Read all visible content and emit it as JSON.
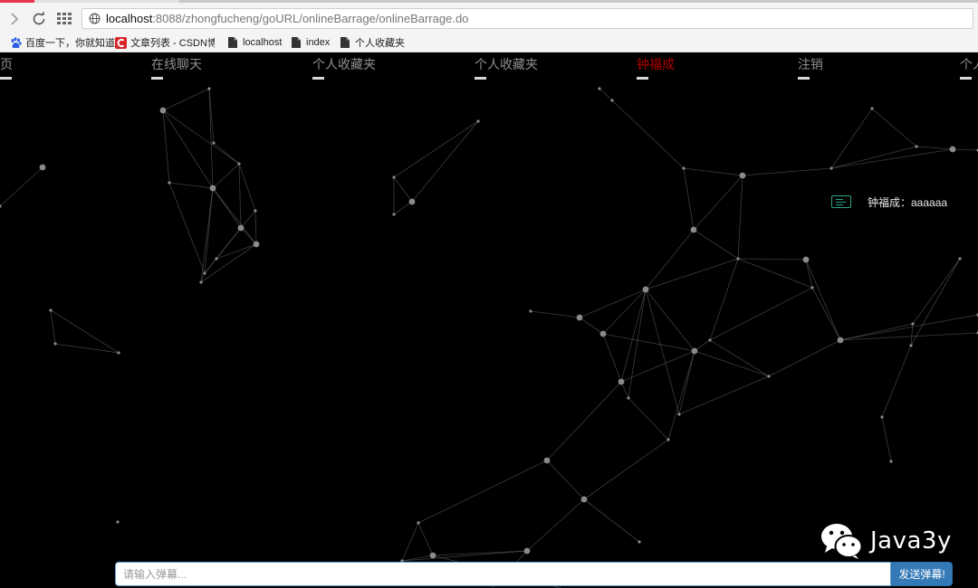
{
  "browser": {
    "url_host": "localhost",
    "url_rest": ":8088/zhongfucheng/goURL/onlineBarrage/onlineBarrage.do"
  },
  "bookmarks": [
    {
      "label": "百度一下，你就知道",
      "icon": "baidu-paw-icon"
    },
    {
      "label": "文章列表 - CSDN博客",
      "icon": "csdn-logo-icon"
    },
    {
      "label": "localhost",
      "icon": "page-icon"
    },
    {
      "label": "index",
      "icon": "page-icon"
    },
    {
      "label": "个人收藏夹",
      "icon": "page-icon"
    }
  ],
  "nav": {
    "items": [
      {
        "label": "页",
        "active": false
      },
      {
        "label": "在线聊天",
        "active": false
      },
      {
        "label": "个人收藏夹",
        "active": false
      },
      {
        "label": "个人收藏夹",
        "active": false
      },
      {
        "label": "钟福成",
        "active": true
      },
      {
        "label": "注销",
        "active": false
      },
      {
        "label": "个人",
        "active": false
      }
    ]
  },
  "barrage": {
    "messages": [
      {
        "text": "钟福成：aaaaaa"
      }
    ],
    "input_placeholder": "请输入弹幕...",
    "send_label": "发送弹幕!"
  },
  "watermark": {
    "text": "Java3y",
    "icon": "wechat-icon"
  },
  "colors": {
    "background": "#000000",
    "nav_text": "#8f8f8f",
    "nav_active": "#b30000",
    "send_button": "#337ab7",
    "barrage_icon": "#2ea38a"
  }
}
